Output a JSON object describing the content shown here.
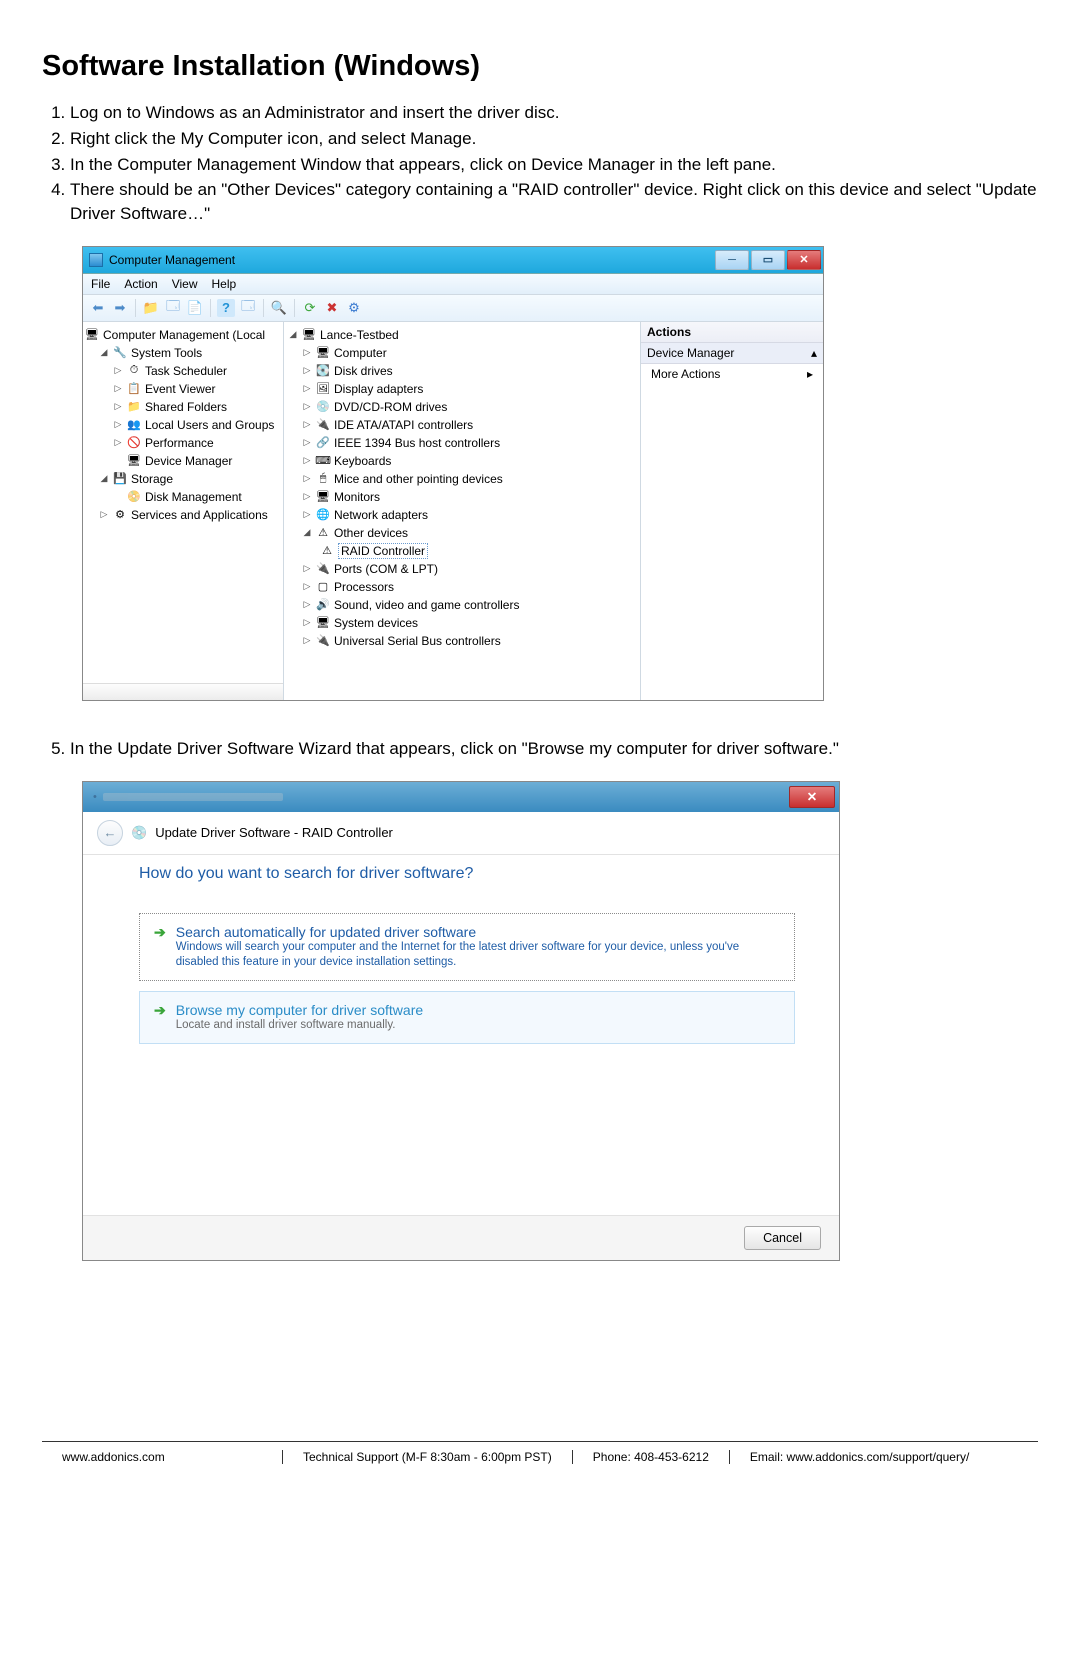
{
  "heading": "Software Installation (Windows)",
  "steps": [
    "Log on to Windows as an Administrator and insert the driver disc.",
    "Right click the My Computer icon, and select Manage.",
    "In the Computer Management Window that appears, click on Device Manager in the left pane.",
    "There should be an \"Other Devices\" category containing a \"RAID controller\" device. Right click on this device and select \"Update Driver Software…\""
  ],
  "step5": "In the Update Driver Software Wizard that appears, click on \"Browse my computer for driver software.\"",
  "cm": {
    "title": "Computer Management",
    "menus": [
      "File",
      "Action",
      "View",
      "Help"
    ],
    "leftRoot": "Computer Management (Local",
    "left": [
      {
        "l": "System Tools",
        "ind": 1,
        "exp": "▾",
        "ico": "🔧"
      },
      {
        "l": "Task Scheduler",
        "ind": 2,
        "exp": "▹",
        "ico": "⏱"
      },
      {
        "l": "Event Viewer",
        "ind": 2,
        "exp": "▹",
        "ico": "📋"
      },
      {
        "l": "Shared Folders",
        "ind": 2,
        "exp": "▹",
        "ico": "📁"
      },
      {
        "l": "Local Users and Groups",
        "ind": 2,
        "exp": "▹",
        "ico": "👥"
      },
      {
        "l": "Performance",
        "ind": 2,
        "exp": "▹",
        "ico": "🚫"
      },
      {
        "l": "Device Manager",
        "ind": 2,
        "exp": "",
        "ico": "🖥"
      },
      {
        "l": "Storage",
        "ind": 1,
        "exp": "▾",
        "ico": "💾"
      },
      {
        "l": "Disk Management",
        "ind": 2,
        "exp": "",
        "ico": "📀"
      },
      {
        "l": "Services and Applications",
        "ind": 1,
        "exp": "▹",
        "ico": "⚙"
      }
    ],
    "midRoot": "Lance-Testbed",
    "devices": [
      {
        "l": "Computer",
        "ico": "🖥"
      },
      {
        "l": "Disk drives",
        "ico": "💽"
      },
      {
        "l": "Display adapters",
        "ico": "🖼"
      },
      {
        "l": "DVD/CD-ROM drives",
        "ico": "💿"
      },
      {
        "l": "IDE ATA/ATAPI controllers",
        "ico": "🔌"
      },
      {
        "l": "IEEE 1394 Bus host controllers",
        "ico": "🔗"
      },
      {
        "l": "Keyboards",
        "ico": "⌨"
      },
      {
        "l": "Mice and other pointing devices",
        "ico": "🖱"
      },
      {
        "l": "Monitors",
        "ico": "🖥"
      },
      {
        "l": "Network adapters",
        "ico": "🌐"
      }
    ],
    "otherDevices": "Other devices",
    "raid": "RAID Controller",
    "devices2": [
      {
        "l": "Ports (COM & LPT)",
        "ico": "🔌"
      },
      {
        "l": "Processors",
        "ico": "▢"
      },
      {
        "l": "Sound, video and game controllers",
        "ico": "🔊"
      },
      {
        "l": "System devices",
        "ico": "🖥"
      },
      {
        "l": "Universal Serial Bus controllers",
        "ico": "🔌"
      }
    ],
    "actionsHeader": "Actions",
    "actionsSub": "Device Manager",
    "moreActions": "More Actions"
  },
  "wizard": {
    "crumb": "Update Driver Software - RAID Controller",
    "heading": "How do you want to search for driver software?",
    "opt1Title": "Search automatically for updated driver software",
    "opt1Sub": "Windows will search your computer and the Internet for the latest driver software for your device, unless you've disabled this feature in your device installation settings.",
    "opt2Title": "Browse my computer for driver software",
    "opt2Sub": "Locate and install driver software manually.",
    "cancel": "Cancel"
  },
  "footer": {
    "url": "www.addonics.com",
    "support": "Technical Support (M-F 8:30am - 6:00pm PST)",
    "phone": "Phone: 408-453-6212",
    "email": "Email: www.addonics.com/support/query/"
  }
}
